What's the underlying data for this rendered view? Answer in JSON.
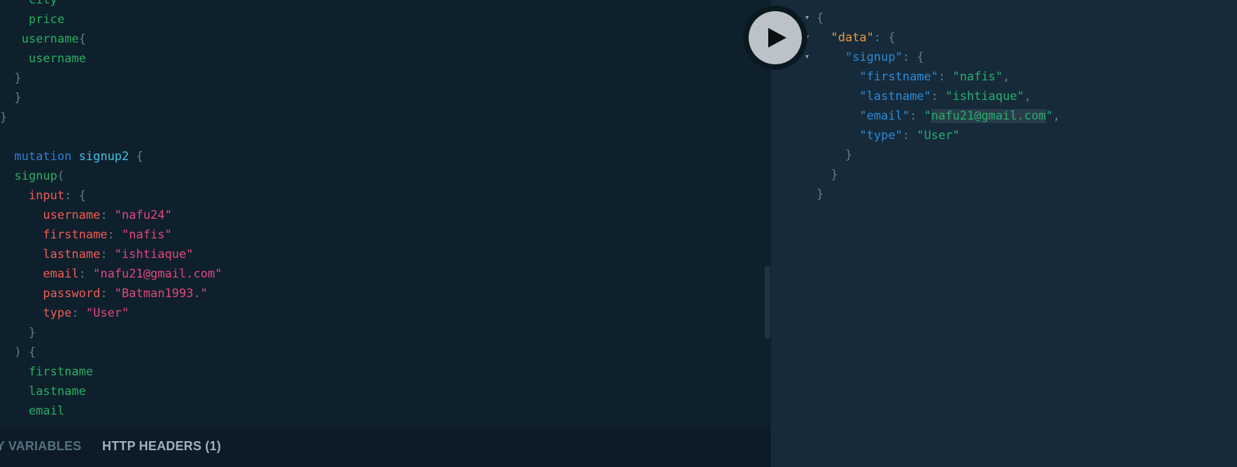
{
  "editor": {
    "lines": [
      {
        "indent": "    ",
        "tokens": [
          {
            "t": "city",
            "c": "fld"
          }
        ]
      },
      {
        "indent": "    ",
        "tokens": [
          {
            "t": "price",
            "c": "fld"
          }
        ]
      },
      {
        "indent": "   ",
        "tokens": [
          {
            "t": "username",
            "c": "fld"
          },
          {
            "t": "{",
            "c": "p"
          }
        ]
      },
      {
        "indent": "    ",
        "tokens": [
          {
            "t": "username",
            "c": "fld"
          }
        ]
      },
      {
        "indent": "  ",
        "tokens": [
          {
            "t": "}",
            "c": "p"
          }
        ]
      },
      {
        "indent": "  ",
        "tokens": [
          {
            "t": "}",
            "c": "p"
          }
        ]
      },
      {
        "indent": "",
        "tokens": [
          {
            "t": "}",
            "c": "p"
          }
        ]
      },
      {
        "indent": "",
        "tokens": []
      },
      {
        "indent": "  ",
        "tokens": [
          {
            "t": "mutation",
            "c": "kw"
          },
          {
            "t": " ",
            "c": "p"
          },
          {
            "t": "signup2",
            "c": "op"
          },
          {
            "t": " {",
            "c": "p"
          }
        ]
      },
      {
        "indent": "  ",
        "tokens": [
          {
            "t": "signup",
            "c": "fld"
          },
          {
            "t": "(",
            "c": "p"
          }
        ]
      },
      {
        "indent": "    ",
        "tokens": [
          {
            "t": "input",
            "c": "arg"
          },
          {
            "t": ": {",
            "c": "p"
          }
        ]
      },
      {
        "indent": "      ",
        "tokens": [
          {
            "t": "username",
            "c": "arg"
          },
          {
            "t": ": ",
            "c": "p"
          },
          {
            "t": "\"nafu24\"",
            "c": "str"
          }
        ]
      },
      {
        "indent": "      ",
        "tokens": [
          {
            "t": "firstname",
            "c": "arg"
          },
          {
            "t": ": ",
            "c": "p"
          },
          {
            "t": "\"nafis\"",
            "c": "str"
          }
        ]
      },
      {
        "indent": "      ",
        "tokens": [
          {
            "t": "lastname",
            "c": "arg"
          },
          {
            "t": ": ",
            "c": "p"
          },
          {
            "t": "\"ishtiaque\"",
            "c": "str"
          }
        ]
      },
      {
        "indent": "      ",
        "tokens": [
          {
            "t": "email",
            "c": "arg"
          },
          {
            "t": ": ",
            "c": "p"
          },
          {
            "t": "\"nafu21@gmail.com\"",
            "c": "str"
          }
        ]
      },
      {
        "indent": "      ",
        "tokens": [
          {
            "t": "password",
            "c": "arg"
          },
          {
            "t": ": ",
            "c": "p"
          },
          {
            "t": "\"Batman1993.\"",
            "c": "str"
          }
        ]
      },
      {
        "indent": "      ",
        "tokens": [
          {
            "t": "type",
            "c": "arg"
          },
          {
            "t": ": ",
            "c": "p"
          },
          {
            "t": "\"User\"",
            "c": "str"
          }
        ]
      },
      {
        "indent": "    ",
        "tokens": [
          {
            "t": "}",
            "c": "p"
          }
        ]
      },
      {
        "indent": "  ",
        "tokens": [
          {
            "t": ") {",
            "c": "p"
          }
        ]
      },
      {
        "indent": "    ",
        "tokens": [
          {
            "t": "firstname",
            "c": "fld"
          }
        ]
      },
      {
        "indent": "    ",
        "tokens": [
          {
            "t": "lastname",
            "c": "fld"
          }
        ]
      },
      {
        "indent": "    ",
        "tokens": [
          {
            "t": "email",
            "c": "fld"
          }
        ]
      }
    ]
  },
  "bottom_bar": {
    "variables_tab": "ery variables",
    "headers_tab": "HTTP HEADERS (1)"
  },
  "play_button": {
    "icon": "play-icon"
  },
  "results": {
    "lines": [
      {
        "indent": "",
        "fold": true,
        "tokens": [
          {
            "t": "{",
            "c": "p"
          }
        ]
      },
      {
        "indent": "  ",
        "fold": true,
        "tokens": [
          {
            "t": "\"data\"",
            "c": "jkey-a"
          },
          {
            "t": ": {",
            "c": "p"
          }
        ]
      },
      {
        "indent": "    ",
        "fold": true,
        "tokens": [
          {
            "t": "\"signup\"",
            "c": "jkey"
          },
          {
            "t": ": {",
            "c": "p"
          }
        ]
      },
      {
        "indent": "      ",
        "fold": false,
        "tokens": [
          {
            "t": "\"firstname\"",
            "c": "jkey"
          },
          {
            "t": ": ",
            "c": "p"
          },
          {
            "t": "\"nafis\"",
            "c": "jstr"
          },
          {
            "t": ",",
            "c": "p"
          }
        ]
      },
      {
        "indent": "      ",
        "fold": false,
        "tokens": [
          {
            "t": "\"lastname\"",
            "c": "jkey"
          },
          {
            "t": ": ",
            "c": "p"
          },
          {
            "t": "\"ishtiaque\"",
            "c": "jstr"
          },
          {
            "t": ",",
            "c": "p"
          }
        ]
      },
      {
        "indent": "      ",
        "fold": false,
        "tokens": [
          {
            "t": "\"email\"",
            "c": "jkey"
          },
          {
            "t": ": ",
            "c": "p"
          },
          {
            "t": "\"",
            "c": "jstr"
          },
          {
            "t": "nafu21@gmail.com",
            "c": "jstr hl"
          },
          {
            "t": "\"",
            "c": "jstr"
          },
          {
            "t": ",",
            "c": "p"
          }
        ]
      },
      {
        "indent": "      ",
        "fold": false,
        "tokens": [
          {
            "t": "\"type\"",
            "c": "jkey"
          },
          {
            "t": ": ",
            "c": "p"
          },
          {
            "t": "\"User\"",
            "c": "jstr"
          }
        ]
      },
      {
        "indent": "    ",
        "fold": false,
        "tokens": [
          {
            "t": "}",
            "c": "p"
          }
        ]
      },
      {
        "indent": "  ",
        "fold": false,
        "tokens": [
          {
            "t": "}",
            "c": "p"
          }
        ]
      },
      {
        "indent": "",
        "fold": false,
        "tokens": [
          {
            "t": "}",
            "c": "p"
          }
        ]
      }
    ]
  },
  "colors": {
    "editor_bg": "#0f202d",
    "results_bg": "#172a3a",
    "keyword": "#2d7dd2",
    "field": "#27ae60",
    "argument": "#f25c54",
    "string": "#e0487a",
    "json_key": "#2d8ad8",
    "json_string": "#25b06c",
    "data_key": "#ea9b3e"
  }
}
